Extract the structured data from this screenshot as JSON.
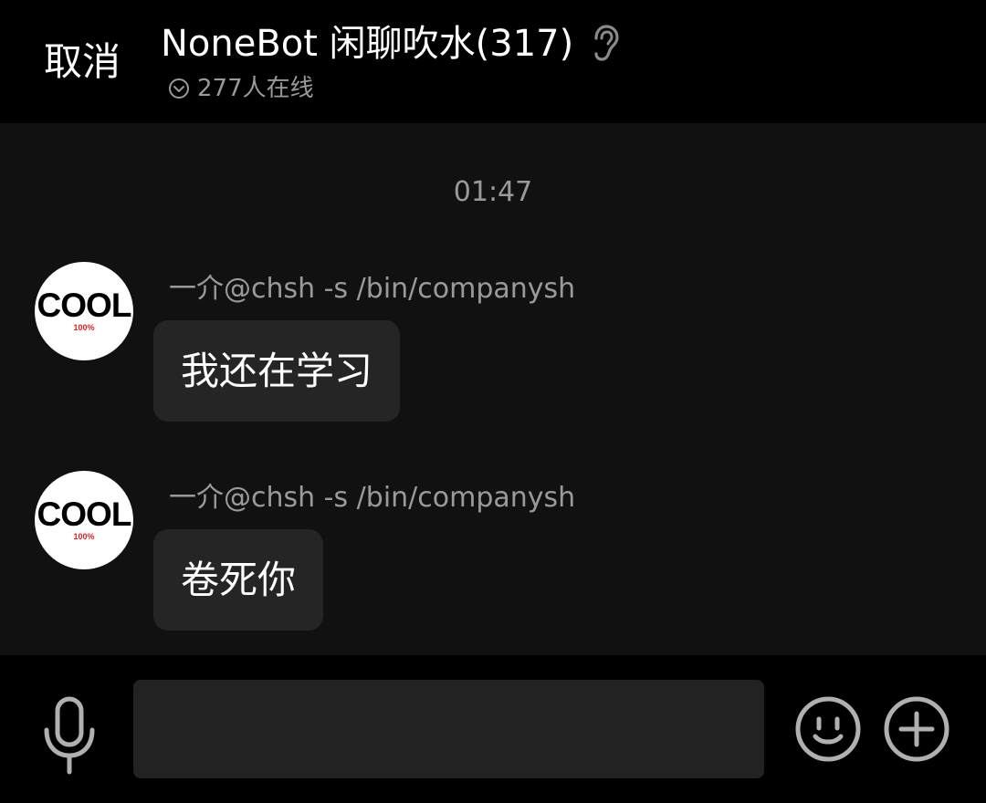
{
  "header": {
    "cancel_label": "取消",
    "title": "NoneBot 闲聊吹水(317)",
    "online_text": "277人在线"
  },
  "chat": {
    "timestamp": "01:47",
    "messages": [
      {
        "avatar": {
          "main": "COOL",
          "sub": "100%"
        },
        "sender": "一介@chsh -s /bin/companysh",
        "text": "我还在学习"
      },
      {
        "avatar": {
          "main": "COOL",
          "sub": "100%"
        },
        "sender": "一介@chsh -s /bin/companysh",
        "text": "卷死你"
      }
    ]
  },
  "input": {
    "value": "",
    "placeholder": ""
  },
  "icons": {
    "ear": "ear-icon",
    "online": "chevron-down-circle-icon",
    "mic": "microphone-icon",
    "emoji": "emoji-icon",
    "plus": "plus-icon"
  },
  "colors": {
    "header_bg": "#000000",
    "chat_bg": "#111111",
    "bubble_bg": "#252525",
    "input_bg": "#222222",
    "muted_text": "#9a9a9a",
    "avatar_accent": "#e02020"
  }
}
